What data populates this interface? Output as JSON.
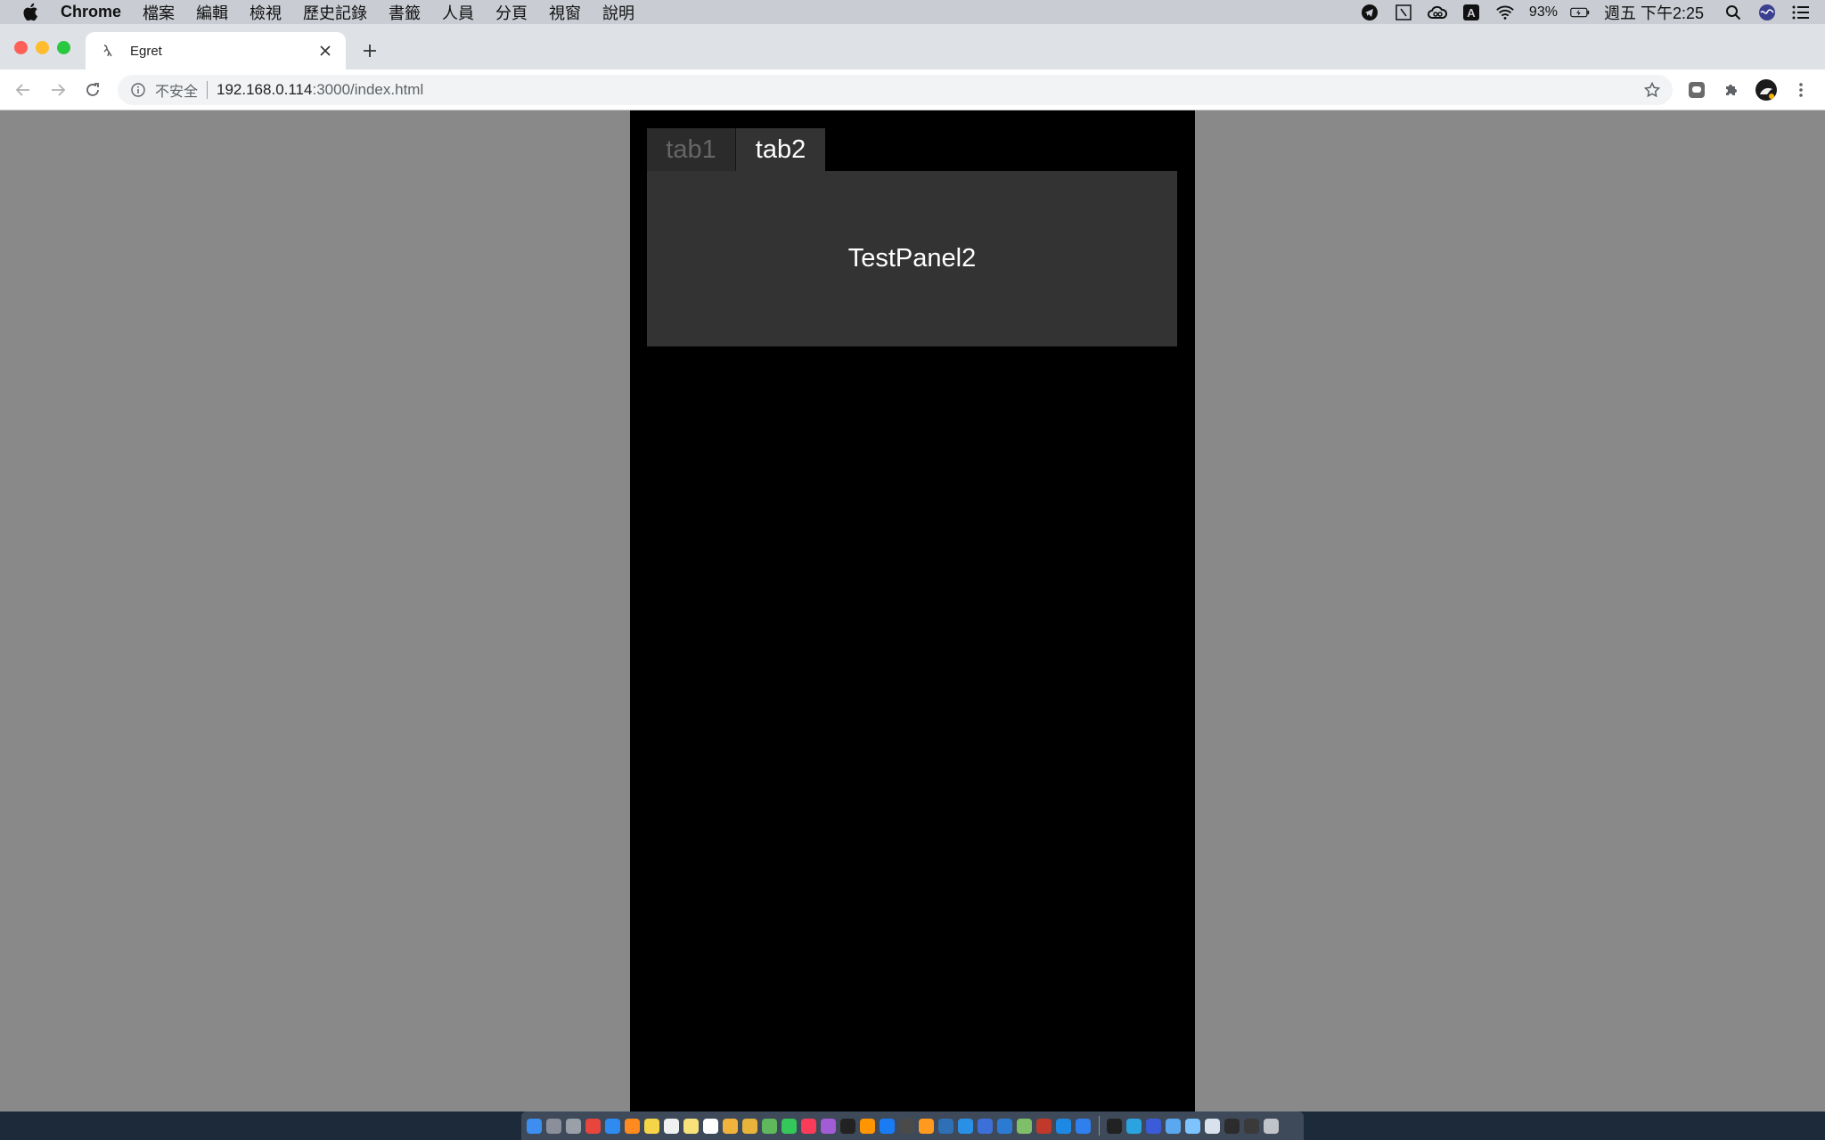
{
  "menubar": {
    "app_name": "Chrome",
    "items": [
      "檔案",
      "編輯",
      "檢視",
      "歷史記錄",
      "書籤",
      "人員",
      "分頁",
      "視窗",
      "說明"
    ],
    "battery": "93%",
    "clock": "週五 下午2:25"
  },
  "browser": {
    "tab_title": "Egret",
    "insecure_label": "不安全",
    "url_host": "192.168.0.114",
    "url_path": ":3000/index.html"
  },
  "game": {
    "tabs": [
      {
        "label": "tab1",
        "active": false
      },
      {
        "label": "tab2",
        "active": true
      }
    ],
    "panel_title": "TestPanel2"
  },
  "colors": {
    "page_bg": "#898989",
    "stage_bg": "#000000",
    "panel_bg": "#333333",
    "tab_inactive_text": "#666666",
    "tab_active_text": "#ffffff"
  },
  "dock": {
    "icons": [
      "finder",
      "launchpad",
      "system-preferences",
      "chrome",
      "safari",
      "firefox",
      "notes",
      "calendar",
      "notes-yellow",
      "reminders",
      "photos",
      "chrome-canary",
      "maps",
      "messages",
      "music",
      "podcasts",
      "apple-tv",
      "books",
      "app-store",
      "activity-monitor",
      "sublime-text",
      "virtualbox",
      "xcode",
      "simulator",
      "sourcetree",
      "network-utility",
      "filezilla",
      "egret-wing",
      "vscode"
    ],
    "right_icons": [
      "terminal",
      "telegram",
      "xcode-instruments",
      "folder",
      "downloads",
      "mail",
      "screen",
      "display",
      "trash"
    ]
  }
}
